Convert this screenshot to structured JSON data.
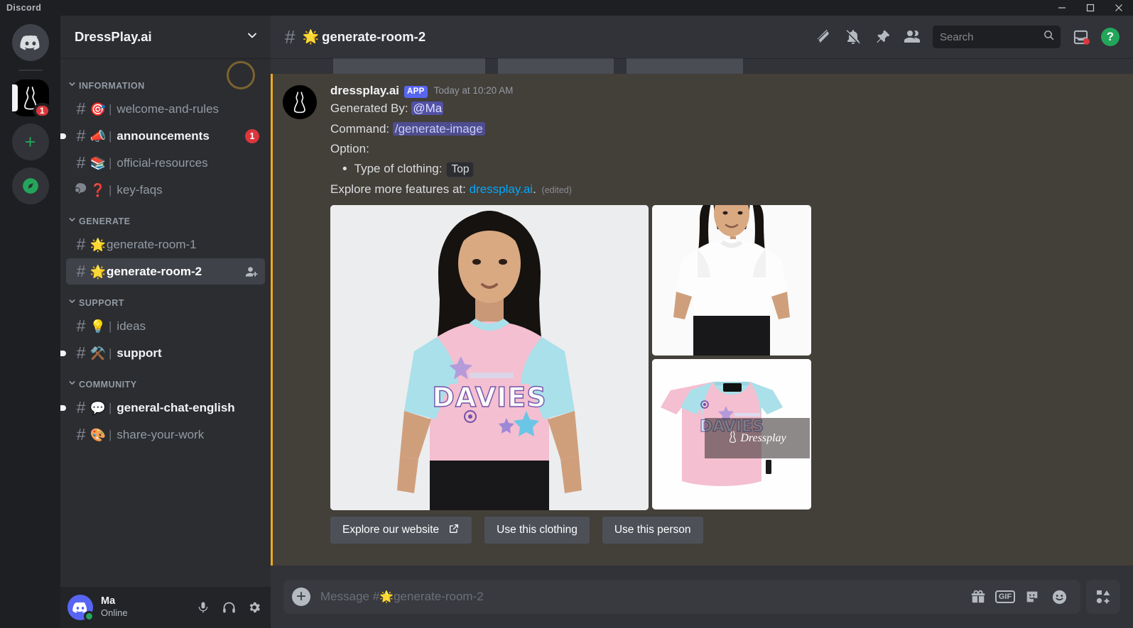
{
  "window": {
    "app_title": "Discord",
    "minimize_label": "Minimize",
    "maximize_label": "Maximize",
    "close_label": "Close"
  },
  "server_rail": {
    "items": [
      {
        "name": "home",
        "icon": "discord-home-icon",
        "label": "Discord",
        "badge": ""
      },
      {
        "name": "dressplay-server",
        "icon": "dress-icon",
        "label": "DressPlay.ai",
        "badge": "1"
      },
      {
        "name": "add-server",
        "icon": "plus-icon",
        "label": "Add a Server",
        "badge": ""
      },
      {
        "name": "explore",
        "icon": "compass-icon",
        "label": "Explore Discoverable Servers",
        "badge": ""
      }
    ]
  },
  "sidebar": {
    "server_name": "DressPlay.ai",
    "categories": [
      {
        "label": "INFORMATION",
        "channels": [
          {
            "emoji": "🎯",
            "name": "welcome-and-rules",
            "state": "read",
            "badge": "",
            "separator": "|",
            "icon": "hash-icon"
          },
          {
            "emoji": "📣",
            "name": "announcements",
            "state": "unread",
            "badge": "1",
            "separator": "|",
            "icon": "hash-icon"
          },
          {
            "emoji": "📚",
            "name": "official-resources",
            "state": "read",
            "badge": "",
            "separator": "|",
            "icon": "hash-icon"
          },
          {
            "emoji": "❓",
            "name": "key-faqs",
            "state": "read",
            "badge": "",
            "separator": "|",
            "icon": "forum-icon"
          }
        ]
      },
      {
        "label": "GENERATE",
        "channels": [
          {
            "emoji": "🌟",
            "name": "generate-room-1",
            "state": "read",
            "badge": "",
            "separator": "",
            "icon": "hash-icon"
          },
          {
            "emoji": "🌟",
            "name": "generate-room-2",
            "state": "selected",
            "badge": "",
            "separator": "",
            "icon": "hash-icon",
            "action": "add-members-icon"
          }
        ]
      },
      {
        "label": "SUPPORT",
        "channels": [
          {
            "emoji": "💡",
            "name": "ideas",
            "state": "read",
            "badge": "",
            "separator": "|",
            "icon": "hash-icon"
          },
          {
            "emoji": "⚒️",
            "name": "support",
            "state": "unread",
            "badge": "",
            "separator": "|",
            "icon": "hash-icon"
          }
        ]
      },
      {
        "label": "COMMUNITY",
        "channels": [
          {
            "emoji": "💬",
            "name": "general-chat-english",
            "state": "unread",
            "badge": "",
            "separator": "|",
            "icon": "hash-icon"
          },
          {
            "emoji": "🎨",
            "name": "share-your-work",
            "state": "read",
            "badge": "",
            "separator": "|",
            "icon": "hash-icon"
          }
        ]
      }
    ]
  },
  "user_panel": {
    "username": "Ma",
    "status": "Online",
    "mute_label": "Mute",
    "deafen_label": "Deafen",
    "settings_label": "User Settings"
  },
  "channel_header": {
    "hash": "#",
    "emoji": "🌟",
    "title": "generate-room-2",
    "tools": [
      {
        "name": "threads-icon",
        "label": "Threads"
      },
      {
        "name": "notification-muted-icon",
        "label": "Notification Settings"
      },
      {
        "name": "pin-icon",
        "label": "Pinned Messages"
      },
      {
        "name": "members-icon",
        "label": "Show Member List"
      }
    ],
    "search_placeholder": "Search",
    "inbox_label": "Inbox",
    "help_label": "Help",
    "help_glyph": "?"
  },
  "message": {
    "author": "dressplay.ai",
    "app_tag": "APP",
    "timestamp": "Today at 10:20 AM",
    "generated_by_label": "Generated By:",
    "generated_by_value": "@Ma",
    "command_label": "Command:",
    "command_value": "/generate-image",
    "option_label": "Option:",
    "option_item_label": "Type of clothing:",
    "option_item_value": "Top",
    "explore_prefix": "Explore more features at:",
    "explore_link": "dressplay.ai",
    "explore_suffix": ".",
    "edited_tag": "(edited)",
    "watermark": "Dressplay",
    "images": [
      {
        "name": "main-generated-image",
        "alt": "Model wearing pink and blue raglan t-shirt"
      },
      {
        "name": "person-reference-image",
        "alt": "Model wearing white t-shirt"
      },
      {
        "name": "clothing-reference-image",
        "alt": "Flat lay pink and blue raglan t-shirt"
      }
    ],
    "buttons": [
      {
        "name": "explore-our-website-button",
        "label": "Explore our website",
        "icon": "external-link-icon"
      },
      {
        "name": "use-this-clothing-button",
        "label": "Use this clothing",
        "icon": ""
      },
      {
        "name": "use-this-person-button",
        "label": "Use this person",
        "icon": ""
      }
    ]
  },
  "composer": {
    "placeholder_prefix": "Message #",
    "placeholder_emoji": "🌟",
    "placeholder_channel": "generate-room-2",
    "attach_label": "Attach a file",
    "tools": [
      {
        "name": "gift-icon",
        "label": "Gift",
        "text": ""
      },
      {
        "name": "gif-icon",
        "label": "GIF",
        "text": "GIF"
      },
      {
        "name": "sticker-icon",
        "label": "Sticker",
        "text": ""
      },
      {
        "name": "emoji-icon",
        "label": "Emoji",
        "text": ""
      }
    ],
    "apps_label": "Apps"
  },
  "colors": {
    "brand": "#5865f2",
    "mention_bg": "#433f39",
    "mention_bar": "#f0a91c",
    "online": "#23a55a",
    "danger": "#da373c",
    "link": "#00a8fc"
  }
}
